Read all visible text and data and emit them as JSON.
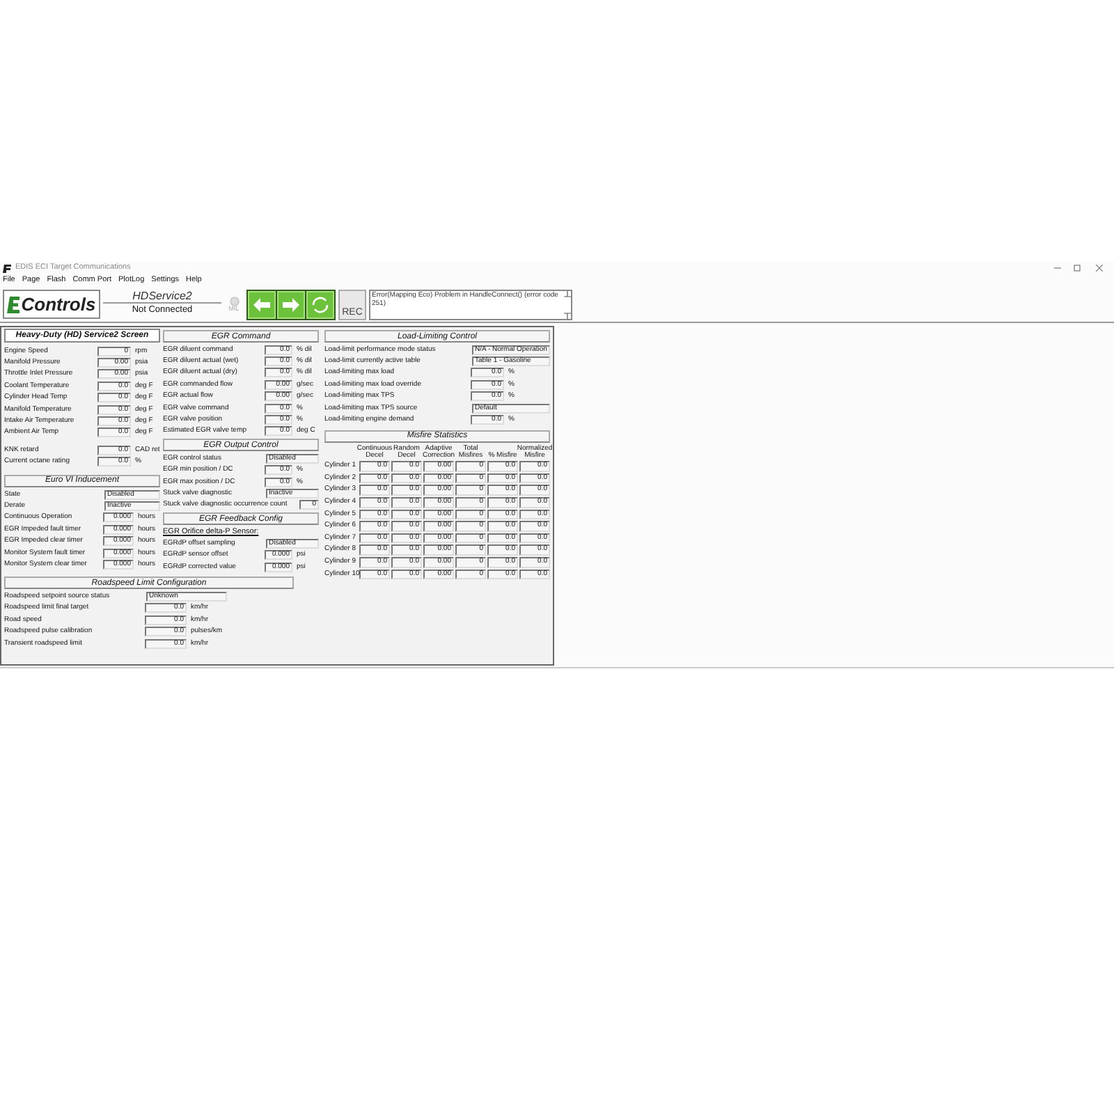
{
  "window": {
    "title": "EDIS ECI Target Communications"
  },
  "menu": [
    "File",
    "Page",
    "Flash",
    "Comm Port",
    "PlotLog",
    "Settings",
    "Help"
  ],
  "toolbar": {
    "logo_text": "Controls",
    "page_name": "HDService2",
    "connection": "Not Connected",
    "mil": "MIL",
    "rec": "REC",
    "message": "Error(Mapping Eco) Problem in HandleConnect() (error code 251)"
  },
  "panel": {
    "title": "Heavy-Duty (HD) Service2 Screen",
    "sensors": [
      {
        "label": "Engine Speed",
        "value": "0",
        "unit": "rpm",
        "kind": "number"
      },
      {
        "label": "Manifold Pressure",
        "value": "0.00",
        "unit": "psia",
        "kind": "number"
      },
      {
        "label": "Throttle Inlet Pressure",
        "value": "0.00",
        "unit": "psia",
        "kind": "number"
      },
      {
        "label": "Coolant Temperature",
        "value": "0.0",
        "unit": "deg F",
        "kind": "number"
      },
      {
        "label": "Cylinder Head Temp",
        "value": "0.0",
        "unit": "deg F",
        "kind": "number"
      },
      {
        "label": "Manifold Temperature",
        "value": "0.0",
        "unit": "deg F",
        "kind": "number"
      },
      {
        "label": "Intake Air Temperature",
        "value": "0.0",
        "unit": "deg F",
        "kind": "number"
      },
      {
        "label": "Ambient Air Temp",
        "value": "0.0",
        "unit": "deg F",
        "kind": "number"
      }
    ],
    "knock": [
      {
        "label": "KNK retard",
        "value": "0.0",
        "unit": "CAD ret",
        "kind": "number"
      },
      {
        "label": "Current octane rating",
        "value": "0.0",
        "unit": "%",
        "kind": "number"
      }
    ],
    "euro_vi": {
      "title": "Euro VI Inducement",
      "rows": [
        {
          "label": "State",
          "value": "Disabled",
          "kind": "text"
        },
        {
          "label": "Derate",
          "value": "Inactive",
          "kind": "text"
        },
        {
          "label": "Continuous Operation",
          "value": "0.000",
          "unit": "hours",
          "kind": "number"
        },
        {
          "label": "EGR Impeded fault timer",
          "value": "0.000",
          "unit": "hours",
          "kind": "number"
        },
        {
          "label": "EGR Impeded clear timer",
          "value": "0.000",
          "unit": "hours",
          "kind": "number"
        },
        {
          "label": "Monitor System fault timer",
          "value": "0.000",
          "unit": "hours",
          "kind": "number"
        },
        {
          "label": "Monitor System clear timer",
          "value": "0.000",
          "unit": "hours",
          "kind": "number"
        }
      ]
    },
    "egr_command": {
      "title": "EGR Command",
      "rows": [
        {
          "label": "EGR diluent command",
          "value": "0.0",
          "unit": "% dil",
          "kind": "number"
        },
        {
          "label": "EGR diluent actual (wet)",
          "value": "0.0",
          "unit": "% dil",
          "kind": "number"
        },
        {
          "label": "EGR diluent actual (dry)",
          "value": "0.0",
          "unit": "% dil",
          "kind": "number"
        },
        {
          "label": "EGR commanded flow",
          "value": "0.00",
          "unit": "g/sec",
          "kind": "number"
        },
        {
          "label": "EGR actual flow",
          "value": "0.00",
          "unit": "g/sec",
          "kind": "number"
        },
        {
          "label": "EGR valve command",
          "value": "0.0",
          "unit": "%",
          "kind": "number"
        },
        {
          "label": "EGR valve position",
          "value": "0.0",
          "unit": "%",
          "kind": "number"
        },
        {
          "label": "Estimated EGR valve temp",
          "value": "0.0",
          "unit": "deg C",
          "kind": "number"
        }
      ]
    },
    "egr_output": {
      "title": "EGR Output Control",
      "rows": [
        {
          "label": "EGR control status",
          "value": "Disabled",
          "kind": "text"
        },
        {
          "label": "EGR min position / DC",
          "value": "0.0",
          "unit": "%",
          "kind": "number"
        },
        {
          "label": "EGR max position / DC",
          "value": "0.0",
          "unit": "%",
          "kind": "number"
        },
        {
          "label": "Stuck valve diagnostic",
          "value": "Inactive",
          "kind": "text"
        },
        {
          "label": "Stuck valve diagnostic occurrence count",
          "value": "0",
          "kind": "count"
        }
      ]
    },
    "egr_feedback": {
      "title": "EGR Feedback Config",
      "subtitle": "EGR Orifice delta-P Sensor:",
      "rows": [
        {
          "label": "EGRdP offset sampling",
          "value": "Disabled",
          "kind": "text"
        },
        {
          "label": "EGRdP sensor offset",
          "value": "0.000",
          "unit": "psi",
          "kind": "number"
        },
        {
          "label": "EGRdP corrected value",
          "value": "0.000",
          "unit": "psi",
          "kind": "number"
        }
      ]
    },
    "roadspeed": {
      "title": "Roadspeed Limit Configuration",
      "rows": [
        {
          "label": "Roadspeed setpoint source status",
          "value": "Unknown",
          "kind": "text"
        },
        {
          "label": "Roadspeed limit final target",
          "value": "0.0",
          "unit": "km/hr",
          "kind": "number"
        },
        {
          "label": "Road speed",
          "value": "0.0",
          "unit": "km/hr",
          "kind": "number"
        },
        {
          "label": "Roadspeed pulse calibration",
          "value": "0.0",
          "unit": "pulses/km",
          "kind": "number"
        },
        {
          "label": "Transient roadspeed limit",
          "value": "0.0",
          "unit": "km/hr",
          "kind": "number"
        }
      ]
    },
    "load_limiting": {
      "title": "Load-Limiting Control",
      "rows": [
        {
          "label": "Load-limit performance mode status",
          "value": "N/A - Normal Operation",
          "kind": "text"
        },
        {
          "label": "Load-limit currently active table",
          "value": "Table 1 - Gasoline",
          "kind": "text"
        },
        {
          "label": "Load-limiting max load",
          "value": "0.0",
          "unit": "%",
          "kind": "number"
        },
        {
          "label": "Load-limiting max load override",
          "value": "0.0",
          "unit": "%",
          "kind": "number"
        },
        {
          "label": "Load-limiting max TPS",
          "value": "0.0",
          "unit": "%",
          "kind": "number"
        },
        {
          "label": "Load-limiting max TPS source",
          "value": "Default",
          "kind": "text"
        },
        {
          "label": "Load-limiting engine demand",
          "value": "0.0",
          "unit": "%",
          "kind": "number"
        }
      ]
    },
    "misfire": {
      "title": "Misfire Statistics",
      "columns": [
        "Continuous Decel",
        "Random Decel",
        "Adaptive Correction",
        "Total Misfires",
        "% Misfire",
        "Normalized Misfire"
      ],
      "rows": [
        {
          "label": "Cylinder 1",
          "values": [
            "0.0",
            "0.0",
            "0.00",
            "0",
            "0.0",
            "0.0"
          ]
        },
        {
          "label": "Cylinder 2",
          "values": [
            "0.0",
            "0.0",
            "0.00",
            "0",
            "0.0",
            "0.0"
          ]
        },
        {
          "label": "Cylinder 3",
          "values": [
            "0.0",
            "0.0",
            "0.00",
            "0",
            "0.0",
            "0.0"
          ]
        },
        {
          "label": "Cylinder 4",
          "values": [
            "0.0",
            "0.0",
            "0.00",
            "0",
            "0.0",
            "0.0"
          ]
        },
        {
          "label": "Cylinder 5",
          "values": [
            "0.0",
            "0.0",
            "0.00",
            "0",
            "0.0",
            "0.0"
          ]
        },
        {
          "label": "Cylinder 6",
          "values": [
            "0.0",
            "0.0",
            "0.00",
            "0",
            "0.0",
            "0.0"
          ]
        },
        {
          "label": "Cylinder 7",
          "values": [
            "0.0",
            "0.0",
            "0.00",
            "0",
            "0.0",
            "0.0"
          ]
        },
        {
          "label": "Cylinder 8",
          "values": [
            "0.0",
            "0.0",
            "0.00",
            "0",
            "0.0",
            "0.0"
          ]
        },
        {
          "label": "Cylinder 9",
          "values": [
            "0.0",
            "0.0",
            "0.00",
            "0",
            "0.0",
            "0.0"
          ]
        },
        {
          "label": "Cylinder 10",
          "values": [
            "0.0",
            "0.0",
            "0.00",
            "0",
            "0.0",
            "0.0"
          ]
        }
      ]
    }
  }
}
